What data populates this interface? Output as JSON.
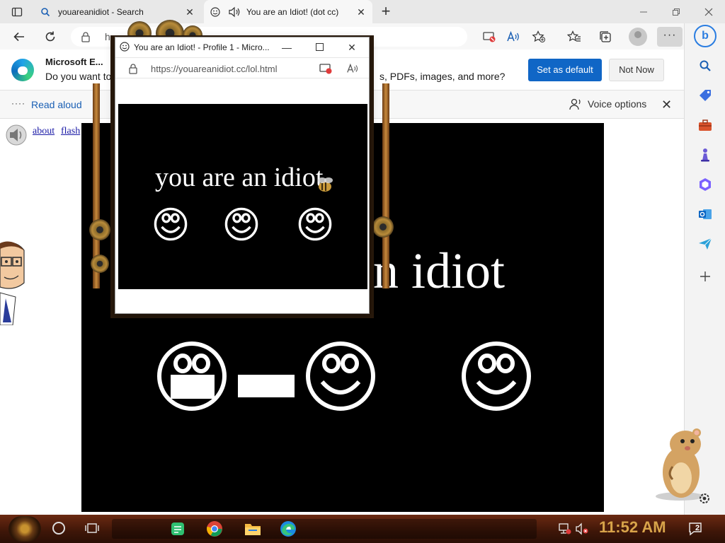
{
  "browser": {
    "tabs": [
      {
        "title": "youareanidiot - Search",
        "icon": "search-icon"
      },
      {
        "title": "You are an Idiot! (dot cc)",
        "icon": "smiley-icon",
        "audio": "speaker-icon"
      }
    ],
    "address_partial": "h"
  },
  "default_bar": {
    "title": "Microsoft E...",
    "text": "Do you want to",
    "text_tail": "s, PDFs, images, and more?",
    "set_default": "Set as default",
    "not_now": "Not Now"
  },
  "read_aloud": {
    "label": "Read aloud",
    "voice_options": "Voice options"
  },
  "page": {
    "link_about": "about",
    "link_flash": "flash",
    "big_text": "n idiot",
    "stage_color": "#000000"
  },
  "popup": {
    "title": "You are an Idiot! - Profile 1 - Micro...",
    "url": "https://youareanidiot.cc/lol.html",
    "headline": "you are an idiot"
  },
  "taskbar": {
    "time": "11:52 AM",
    "notification_count": "2",
    "apps": [
      "notes-icon",
      "chrome-icon",
      "folder-icon",
      "edge-icon"
    ]
  },
  "colors": {
    "accent": "#1066c6",
    "clock": "#d8a44a",
    "taskbar": "#3e1608"
  }
}
